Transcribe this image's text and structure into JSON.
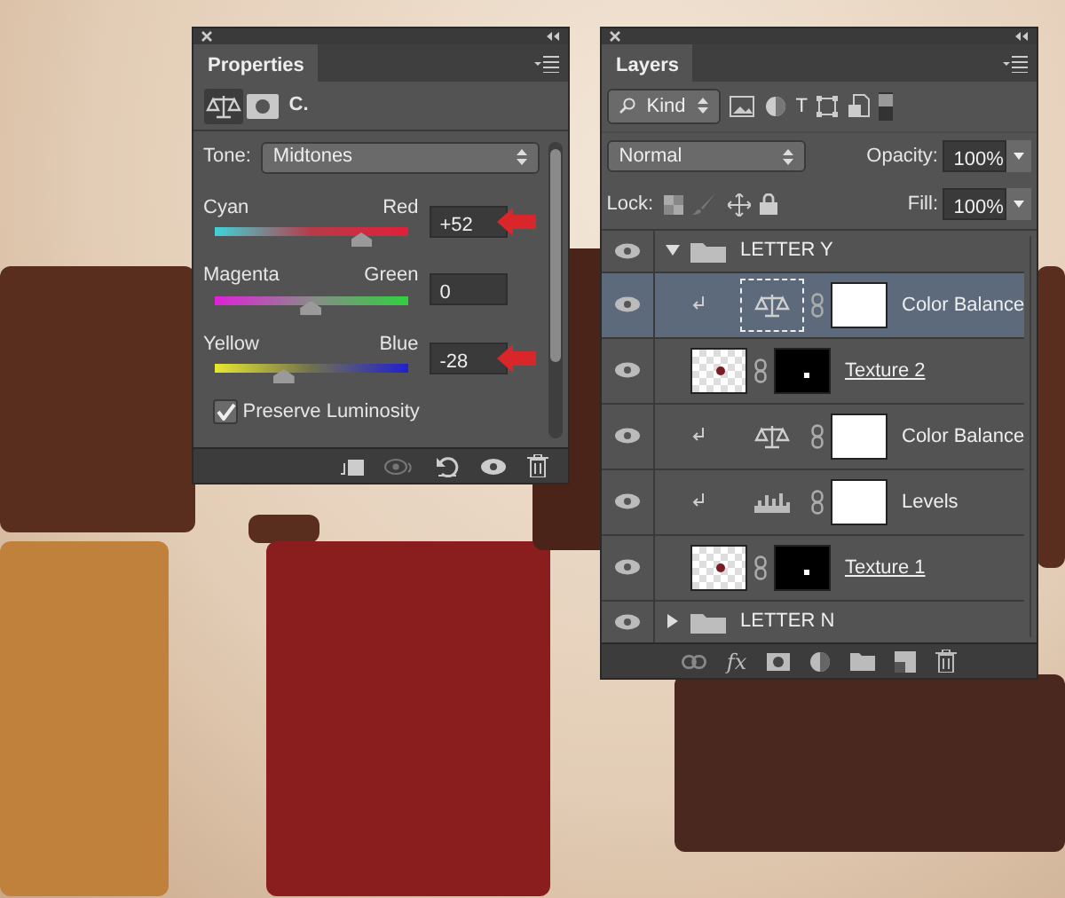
{
  "properties": {
    "tab": "Properties",
    "adjustment_label": "C.",
    "tone": {
      "label": "Tone:",
      "value": "Midtones"
    },
    "sliders": [
      {
        "left": "Cyan",
        "right": "Red",
        "value": "+52",
        "level": 0.76,
        "marked": true
      },
      {
        "left": "Magenta",
        "right": "Green",
        "value": "0",
        "level": 0.5,
        "marked": false
      },
      {
        "left": "Yellow",
        "right": "Blue",
        "value": "-28",
        "level": 0.36,
        "marked": true
      }
    ],
    "preserve_luminosity": {
      "label": "Preserve Luminosity",
      "checked": true
    }
  },
  "layers": {
    "tab": "Layers",
    "filter": "Kind",
    "type_filter": "T",
    "style_button": "fx",
    "blend_mode": "Normal",
    "opacity": {
      "label": "Opacity:",
      "value": "100%"
    },
    "lock_label": "Lock:",
    "fill": {
      "label": "Fill:",
      "value": "100%"
    },
    "items": [
      {
        "kind": "group",
        "name": "LETTER Y",
        "visible": true,
        "expanded": true,
        "selected": false,
        "children": [
          {
            "kind": "color-balance",
            "name": "Color Balance",
            "visible": true,
            "clipped": true,
            "selected": true
          },
          {
            "kind": "pixel",
            "name": "Texture 2",
            "visible": true,
            "clipped": false,
            "selected": false
          },
          {
            "kind": "color-balance",
            "name": "Color Balance",
            "visible": true,
            "clipped": true,
            "selected": false
          },
          {
            "kind": "levels",
            "name": "Levels",
            "visible": true,
            "clipped": true,
            "selected": false
          },
          {
            "kind": "pixel",
            "name": "Texture 1",
            "visible": true,
            "clipped": false,
            "selected": false
          }
        ]
      },
      {
        "kind": "group",
        "name": "LETTER N",
        "visible": true,
        "expanded": false,
        "selected": false
      }
    ]
  }
}
